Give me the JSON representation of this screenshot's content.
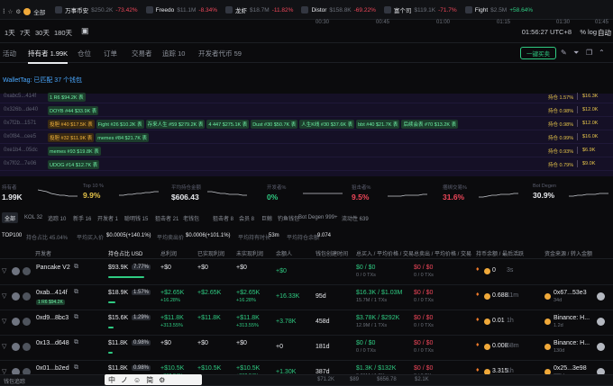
{
  "ticker": [
    {
      "name": "万事币安",
      "value": "$250.2K",
      "chg": "-73.42%",
      "color": "r"
    },
    {
      "name": "Freedo",
      "value": "$11.1M",
      "chg": "-8.34%",
      "color": "r"
    },
    {
      "name": "龙虾",
      "value": "$18.7M",
      "chg": "-11.82%",
      "color": "r"
    },
    {
      "name": "Distor",
      "value": "$158.8K",
      "chg": "-69.22%",
      "color": "r"
    },
    {
      "name": "富个司",
      "value": "$119.1K",
      "chg": "-71.7%",
      "color": "r"
    },
    {
      "name": "Fight",
      "value": "$2.5M",
      "chg": "+58.64%",
      "color": "g"
    }
  ],
  "ticker_all": "全部",
  "timeframes": [
    "1天",
    "7天",
    "30天",
    "180天"
  ],
  "axis_times": [
    "00:30",
    "00:45",
    "01:00",
    "01:15",
    "01:30",
    "01:45"
  ],
  "clock": "01:56:27 UTC+8",
  "pct": "%",
  "log": "log",
  "auto": "自动",
  "tabs": {
    "activity": "活动",
    "holders": "持有者 1.99K",
    "positions": "仓位",
    "orders": "订单",
    "traders": "交易者",
    "tracked": "追踪 10",
    "dev_tokens": "开发者代币 59",
    "buy_button": "一键买卖"
  },
  "wallet": {
    "header": "WalletTag: 已匹配 37 个钱包",
    "rows": [
      {
        "addr": "0xabc5...414f",
        "tags": [
          {
            "t": "1 R6 $94.2K 表",
            "o": false
          }
        ],
        "right": "持仓 1.57%",
        "right2": "$16.3K"
      },
      {
        "addr": "0x326b...de40",
        "tags": [
          {
            "t": "DOYB #44 $33.9K 表",
            "o": false
          }
        ],
        "right": "持仓 0.98%",
        "right2": "$12.0K"
      },
      {
        "addr": "0x7f2b...1571",
        "tags": [
          {
            "t": "投胆 #40 $17.5K 表",
            "o": true
          },
          {
            "t": "Fight #26 $10.2K 表",
            "o": false
          },
          {
            "t": "存来人生 #59 $279.2K 表",
            "o": false
          },
          {
            "t": "4 447 $275.1K 表",
            "o": false
          },
          {
            "t": "Dust #30 $50.7K 表",
            "o": false
          },
          {
            "t": "人生K线 #30 $37.6K 表",
            "o": false
          },
          {
            "t": "bbt #40 $21.7K 表",
            "o": false
          },
          {
            "t": "后续会表 #70 $13.2K 表",
            "o": false
          }
        ],
        "right": "持仓 0.98%",
        "right2": "$12.0K"
      },
      {
        "addr": "0x0f84...cee5",
        "tags": [
          {
            "t": "投胆 #32 $11.9K 表",
            "o": true
          },
          {
            "t": "memes #84 $21.7K 表",
            "o": false
          }
        ],
        "right": "持仓 0.99%",
        "right2": "$16.0K"
      },
      {
        "addr": "0xe1b4...05dc",
        "tags": [
          {
            "t": "memes #93 $19.8K 表",
            "o": false
          }
        ],
        "right": "持仓 0.93%",
        "right2": "$6.9K"
      },
      {
        "addr": "0x7f02...7e06",
        "tags": [
          {
            "t": "UDOG #14 $12.7K 表",
            "o": false
          }
        ],
        "right": "持仓 0.79%",
        "right2": "$9.0K"
      }
    ]
  },
  "stats": [
    {
      "label": "持有者",
      "value": "1.99K",
      "cls": "w",
      "spark": [
        12,
        11,
        10,
        8,
        7,
        6,
        6,
        5,
        5,
        5
      ]
    },
    {
      "label": "Top 10 %",
      "value": "9.9%",
      "cls": "y",
      "spark": [
        6,
        6,
        7,
        7,
        8,
        8,
        9,
        9,
        10,
        10
      ]
    },
    {
      "label": "平均持仓金额",
      "value": "$606.43",
      "cls": "w",
      "spark": [
        10,
        10,
        9,
        8,
        8,
        7,
        7,
        7,
        6,
        6
      ]
    },
    {
      "label": "开发者%",
      "value": "0%",
      "cls": "g",
      "spark": [
        8,
        8,
        8,
        8,
        8,
        8,
        8,
        8,
        8,
        8
      ]
    },
    {
      "label": "狙击者%",
      "value": "9.5%",
      "cls": "r",
      "spark": [
        5,
        5,
        5,
        5,
        6,
        6,
        6,
        6,
        7,
        7
      ]
    },
    {
      "label": "捆绑交易%",
      "value": "31.6%",
      "cls": "r",
      "spark": [
        4,
        4,
        5,
        6,
        6,
        7,
        7,
        7,
        8,
        8
      ]
    },
    {
      "label": "Bot Degen",
      "value": "30.9%",
      "cls": "w",
      "spark": [
        5,
        5,
        6,
        6,
        7,
        7,
        7,
        8,
        8,
        8
      ]
    }
  ],
  "chips": [
    "全部",
    "KOL 32",
    "追踪 10",
    "新手 16",
    "开发者 1",
    "聪明钱 15",
    "狙击者 21",
    "老钱包",
    "狙击者 8",
    "会员 8",
    "巨鲸",
    "钓鱼钱包",
    "Bot Degen 999+",
    "流动性 639"
  ],
  "top100": {
    "label": "TOP100",
    "held": "持仓占比 45.04%",
    "avg_buy": "平均买入价",
    "avg_buy_val": "$0.0005(+140.1%)",
    "avg_sell": "平均卖出价",
    "avg_sell_val": "$0.0006(+101.1%)",
    "avg_hold": "平均持有时长",
    "avg_hold_val": "53m",
    "avg_vol": "平均持仓余额",
    "avg_vol_val": "9.074"
  },
  "columns": [
    "开发者",
    "持仓占比 USD",
    "总利润",
    "已实现利润",
    "未实现利润",
    "余额人",
    "钱包创建时间",
    "总买入 / 平均价格 / 交易",
    "总卖出 / 平均价格 / 交易",
    "持币余额 / 最后活跃",
    "资金来源 / 转入金额"
  ],
  "rows": [
    {
      "name": "Pancake V2",
      "sub": "",
      "tag": "",
      "hold": "$93.9K",
      "pct": "7.77%",
      "tp": "+$0",
      "tps": "",
      "rp": "+$0",
      "rps": "",
      "up": "+$0",
      "ups": "",
      "bal": "+0",
      "created": "",
      "buy": "$0 / $0",
      "buys": "0 / 0 TXs",
      "sell": "$0 / $0",
      "sells": "0 / 0 TXs",
      "coin": "0",
      "last": "3s",
      "src": "",
      "srcs": "",
      "barw": 40
    },
    {
      "name": "0xab...414f",
      "sub": "",
      "tag": "1 R6 $94.2K",
      "hold": "$18.9K",
      "pct": "1.57%",
      "tp": "+$2.65K",
      "tps": "+16.28%",
      "rp": "+$2.65K",
      "rps": "+16.28%",
      "up": "+16.33K",
      "ups": "",
      "bal": "",
      "created": "95d",
      "buy": "$16.3K / $1.03M",
      "buys": "15.7M / 1 TXs",
      "sell": "$0 / $0",
      "sells": "0 / 0 TXs",
      "coin": "0.688",
      "last": "11m",
      "src": "0x67...53e3",
      "srcs": "34d",
      "barw": 8
    },
    {
      "name": "0xd9...8bc3",
      "sub": "",
      "tag": "",
      "hold": "$15.6K",
      "pct": "1.29%",
      "tp": "+$11.8K",
      "tps": "+313.55%",
      "rp": "+$11.8K",
      "rps": "+313.55%",
      "up": "+3.78K",
      "ups": "",
      "bal": "",
      "created": "458d",
      "buy": "$3.78K / $292K",
      "buys": "12.9M / 1 TXs",
      "sell": "$0 / $0",
      "sells": "0 / 0 TXs",
      "coin": "0.01",
      "last": "1h",
      "src": "Binance: H...",
      "srcs": "1.2d",
      "barw": 6
    },
    {
      "name": "0x13...d648",
      "sub": "",
      "tag": "",
      "hold": "$11.8K",
      "pct": "0.98%",
      "tp": "+$0",
      "tps": "",
      "rp": "+$0",
      "rps": "",
      "up": "+0",
      "ups": "",
      "bal": "",
      "created": "181d",
      "buy": "$0 / $0",
      "buys": "0 / 0 TXs",
      "sell": "$0 / $0",
      "sells": "0 / 0 TXs",
      "coin": "0.008",
      "last": "58m",
      "src": "Binance: H...",
      "srcs": "130d",
      "barw": 5
    },
    {
      "name": "0x01...b2ed",
      "sub": "",
      "tag": "DOYB #44 $33.9K",
      "hold": "$11.8K",
      "pct": "0.98%",
      "tp": "+$10.5K",
      "tps": "+802.24%",
      "rp": "+$10.5K",
      "rps": "+802.24%",
      "up": "+1.30K",
      "ups": "",
      "bal": "",
      "created": "387d",
      "buy": "$1.3K / $132K",
      "buys": "9.81M / 1 TXs",
      "sell": "$0 / $0",
      "sells": "0 / 0 TXs",
      "coin": "3.315",
      "last": "1h",
      "src": "0x25...3e98",
      "srcs": "325d",
      "barw": 5
    }
  ],
  "bottom": {
    "left": "钱包追踪",
    "ime": [
      "中",
      "ノ",
      "☺",
      "简",
      "⚙"
    ],
    "prices": [
      "$71.2K",
      "$89",
      "$656.78",
      "$2.1K"
    ]
  }
}
